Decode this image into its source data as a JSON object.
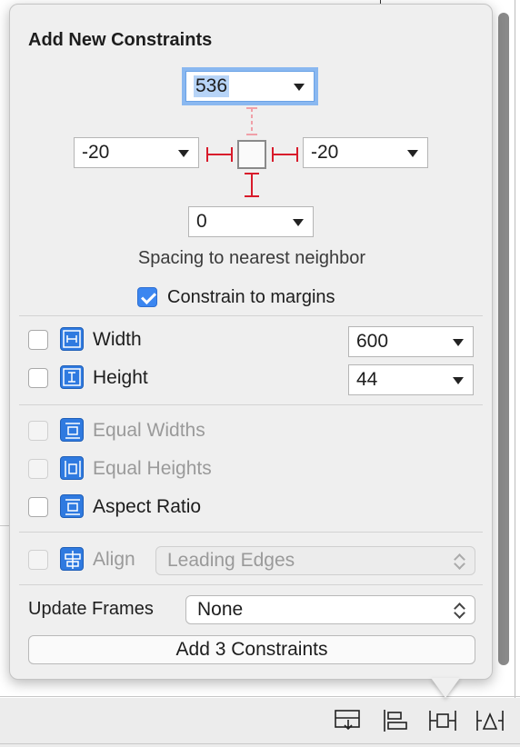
{
  "popover": {
    "title": "Add New Constraints",
    "spacing": {
      "top": "536",
      "left": "-20",
      "right": "-20",
      "bottom": "0",
      "caption": "Spacing to nearest neighbor"
    },
    "constrain_to_margins": {
      "label": "Constrain to margins",
      "checked": true
    },
    "width": {
      "label": "Width",
      "value": "600",
      "checked": false
    },
    "height": {
      "label": "Height",
      "value": "44",
      "checked": false
    },
    "equal_widths": {
      "label": "Equal Widths",
      "enabled": false
    },
    "equal_heights": {
      "label": "Equal Heights",
      "enabled": false
    },
    "aspect_ratio": {
      "label": "Aspect Ratio",
      "checked": false
    },
    "align": {
      "label": "Align",
      "value": "Leading Edges",
      "enabled": false
    },
    "update_frames": {
      "label": "Update Frames",
      "value": "None"
    },
    "add_button": "Add 3 Constraints"
  },
  "toolbar": {
    "icons": [
      "stack-icon",
      "align-icon",
      "pin-icon",
      "resolve-issues-icon"
    ]
  },
  "colors": {
    "accent": "#3b86f0",
    "constraint_red": "#d81b2b",
    "icon_blue": "#2f7ae0"
  }
}
